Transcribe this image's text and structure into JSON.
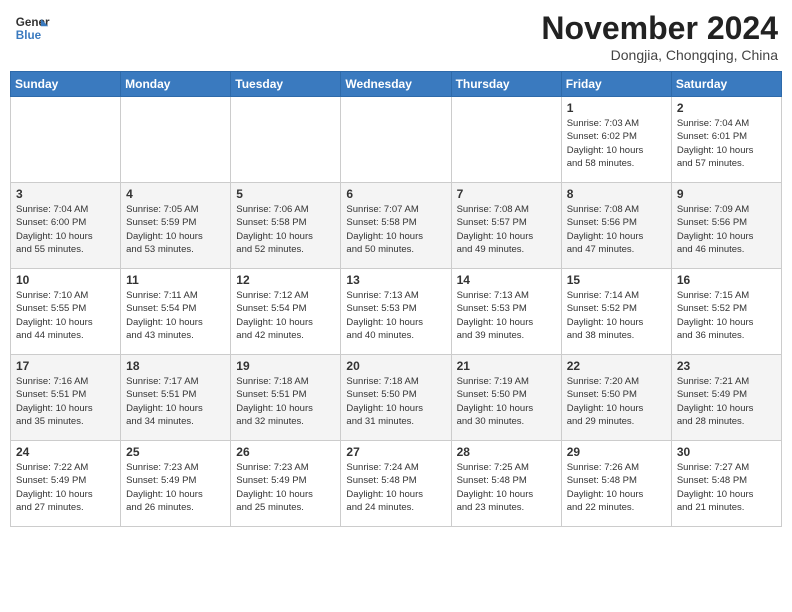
{
  "header": {
    "logo_line1": "General",
    "logo_line2": "Blue",
    "title": "November 2024",
    "location": "Dongjia, Chongqing, China"
  },
  "weekdays": [
    "Sunday",
    "Monday",
    "Tuesday",
    "Wednesday",
    "Thursday",
    "Friday",
    "Saturday"
  ],
  "weeks": [
    [
      {
        "day": "",
        "info": ""
      },
      {
        "day": "",
        "info": ""
      },
      {
        "day": "",
        "info": ""
      },
      {
        "day": "",
        "info": ""
      },
      {
        "day": "",
        "info": ""
      },
      {
        "day": "1",
        "info": "Sunrise: 7:03 AM\nSunset: 6:02 PM\nDaylight: 10 hours\nand 58 minutes."
      },
      {
        "day": "2",
        "info": "Sunrise: 7:04 AM\nSunset: 6:01 PM\nDaylight: 10 hours\nand 57 minutes."
      }
    ],
    [
      {
        "day": "3",
        "info": "Sunrise: 7:04 AM\nSunset: 6:00 PM\nDaylight: 10 hours\nand 55 minutes."
      },
      {
        "day": "4",
        "info": "Sunrise: 7:05 AM\nSunset: 5:59 PM\nDaylight: 10 hours\nand 53 minutes."
      },
      {
        "day": "5",
        "info": "Sunrise: 7:06 AM\nSunset: 5:58 PM\nDaylight: 10 hours\nand 52 minutes."
      },
      {
        "day": "6",
        "info": "Sunrise: 7:07 AM\nSunset: 5:58 PM\nDaylight: 10 hours\nand 50 minutes."
      },
      {
        "day": "7",
        "info": "Sunrise: 7:08 AM\nSunset: 5:57 PM\nDaylight: 10 hours\nand 49 minutes."
      },
      {
        "day": "8",
        "info": "Sunrise: 7:08 AM\nSunset: 5:56 PM\nDaylight: 10 hours\nand 47 minutes."
      },
      {
        "day": "9",
        "info": "Sunrise: 7:09 AM\nSunset: 5:56 PM\nDaylight: 10 hours\nand 46 minutes."
      }
    ],
    [
      {
        "day": "10",
        "info": "Sunrise: 7:10 AM\nSunset: 5:55 PM\nDaylight: 10 hours\nand 44 minutes."
      },
      {
        "day": "11",
        "info": "Sunrise: 7:11 AM\nSunset: 5:54 PM\nDaylight: 10 hours\nand 43 minutes."
      },
      {
        "day": "12",
        "info": "Sunrise: 7:12 AM\nSunset: 5:54 PM\nDaylight: 10 hours\nand 42 minutes."
      },
      {
        "day": "13",
        "info": "Sunrise: 7:13 AM\nSunset: 5:53 PM\nDaylight: 10 hours\nand 40 minutes."
      },
      {
        "day": "14",
        "info": "Sunrise: 7:13 AM\nSunset: 5:53 PM\nDaylight: 10 hours\nand 39 minutes."
      },
      {
        "day": "15",
        "info": "Sunrise: 7:14 AM\nSunset: 5:52 PM\nDaylight: 10 hours\nand 38 minutes."
      },
      {
        "day": "16",
        "info": "Sunrise: 7:15 AM\nSunset: 5:52 PM\nDaylight: 10 hours\nand 36 minutes."
      }
    ],
    [
      {
        "day": "17",
        "info": "Sunrise: 7:16 AM\nSunset: 5:51 PM\nDaylight: 10 hours\nand 35 minutes."
      },
      {
        "day": "18",
        "info": "Sunrise: 7:17 AM\nSunset: 5:51 PM\nDaylight: 10 hours\nand 34 minutes."
      },
      {
        "day": "19",
        "info": "Sunrise: 7:18 AM\nSunset: 5:51 PM\nDaylight: 10 hours\nand 32 minutes."
      },
      {
        "day": "20",
        "info": "Sunrise: 7:18 AM\nSunset: 5:50 PM\nDaylight: 10 hours\nand 31 minutes."
      },
      {
        "day": "21",
        "info": "Sunrise: 7:19 AM\nSunset: 5:50 PM\nDaylight: 10 hours\nand 30 minutes."
      },
      {
        "day": "22",
        "info": "Sunrise: 7:20 AM\nSunset: 5:50 PM\nDaylight: 10 hours\nand 29 minutes."
      },
      {
        "day": "23",
        "info": "Sunrise: 7:21 AM\nSunset: 5:49 PM\nDaylight: 10 hours\nand 28 minutes."
      }
    ],
    [
      {
        "day": "24",
        "info": "Sunrise: 7:22 AM\nSunset: 5:49 PM\nDaylight: 10 hours\nand 27 minutes."
      },
      {
        "day": "25",
        "info": "Sunrise: 7:23 AM\nSunset: 5:49 PM\nDaylight: 10 hours\nand 26 minutes."
      },
      {
        "day": "26",
        "info": "Sunrise: 7:23 AM\nSunset: 5:49 PM\nDaylight: 10 hours\nand 25 minutes."
      },
      {
        "day": "27",
        "info": "Sunrise: 7:24 AM\nSunset: 5:48 PM\nDaylight: 10 hours\nand 24 minutes."
      },
      {
        "day": "28",
        "info": "Sunrise: 7:25 AM\nSunset: 5:48 PM\nDaylight: 10 hours\nand 23 minutes."
      },
      {
        "day": "29",
        "info": "Sunrise: 7:26 AM\nSunset: 5:48 PM\nDaylight: 10 hours\nand 22 minutes."
      },
      {
        "day": "30",
        "info": "Sunrise: 7:27 AM\nSunset: 5:48 PM\nDaylight: 10 hours\nand 21 minutes."
      }
    ]
  ]
}
